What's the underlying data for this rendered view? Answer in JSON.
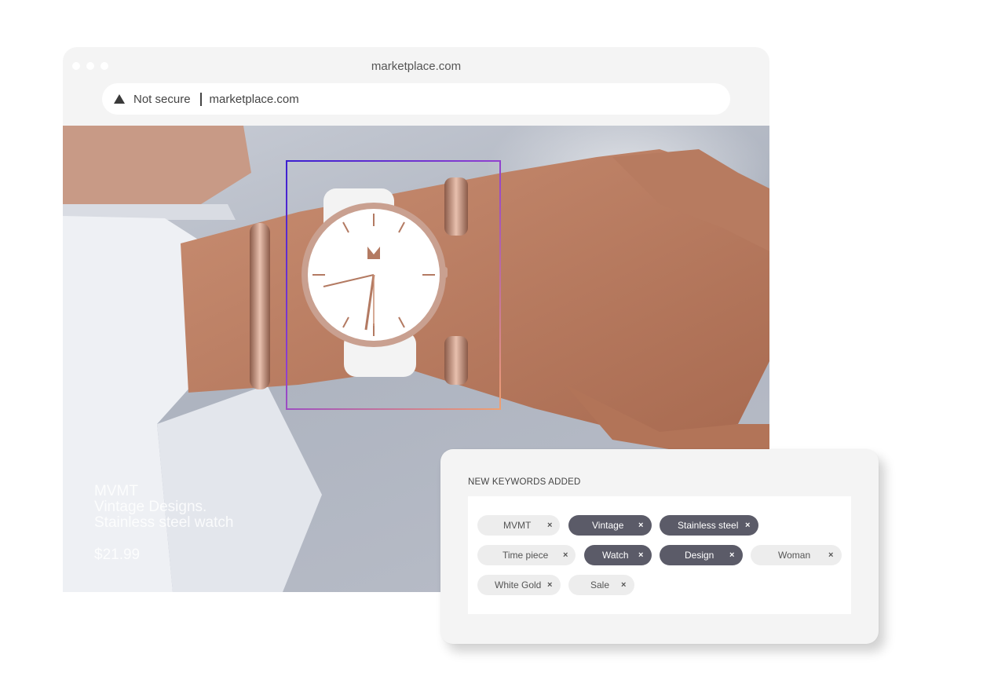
{
  "browser": {
    "window_title": "marketplace.com",
    "security_label": "Not secure",
    "url": "marketplace.com",
    "security_icon": "warning-triangle-icon"
  },
  "product": {
    "brand": "MVMT",
    "line1": "Vintage Designs.",
    "line2": "Stainless steel watch",
    "price": "$21.99"
  },
  "keywords": {
    "heading": "NEW KEYWORDS ADDED",
    "remove_glyph": "×",
    "chips": [
      {
        "label": "MVMT",
        "selected": false
      },
      {
        "label": "Vintage",
        "selected": true
      },
      {
        "label": "Stainless steel",
        "selected": true
      },
      {
        "label": "Time piece",
        "selected": false
      },
      {
        "label": "Watch",
        "selected": true
      },
      {
        "label": "Design",
        "selected": true
      },
      {
        "label": "Woman",
        "selected": false
      },
      {
        "label": "White Gold",
        "selected": false
      },
      {
        "label": "Sale",
        "selected": false
      }
    ]
  },
  "colors": {
    "chip_selected": "#5b5b68",
    "chip_default": "#ededed",
    "detect_gradient_start": "#3b1fd1",
    "detect_gradient_end": "#f0a070"
  }
}
